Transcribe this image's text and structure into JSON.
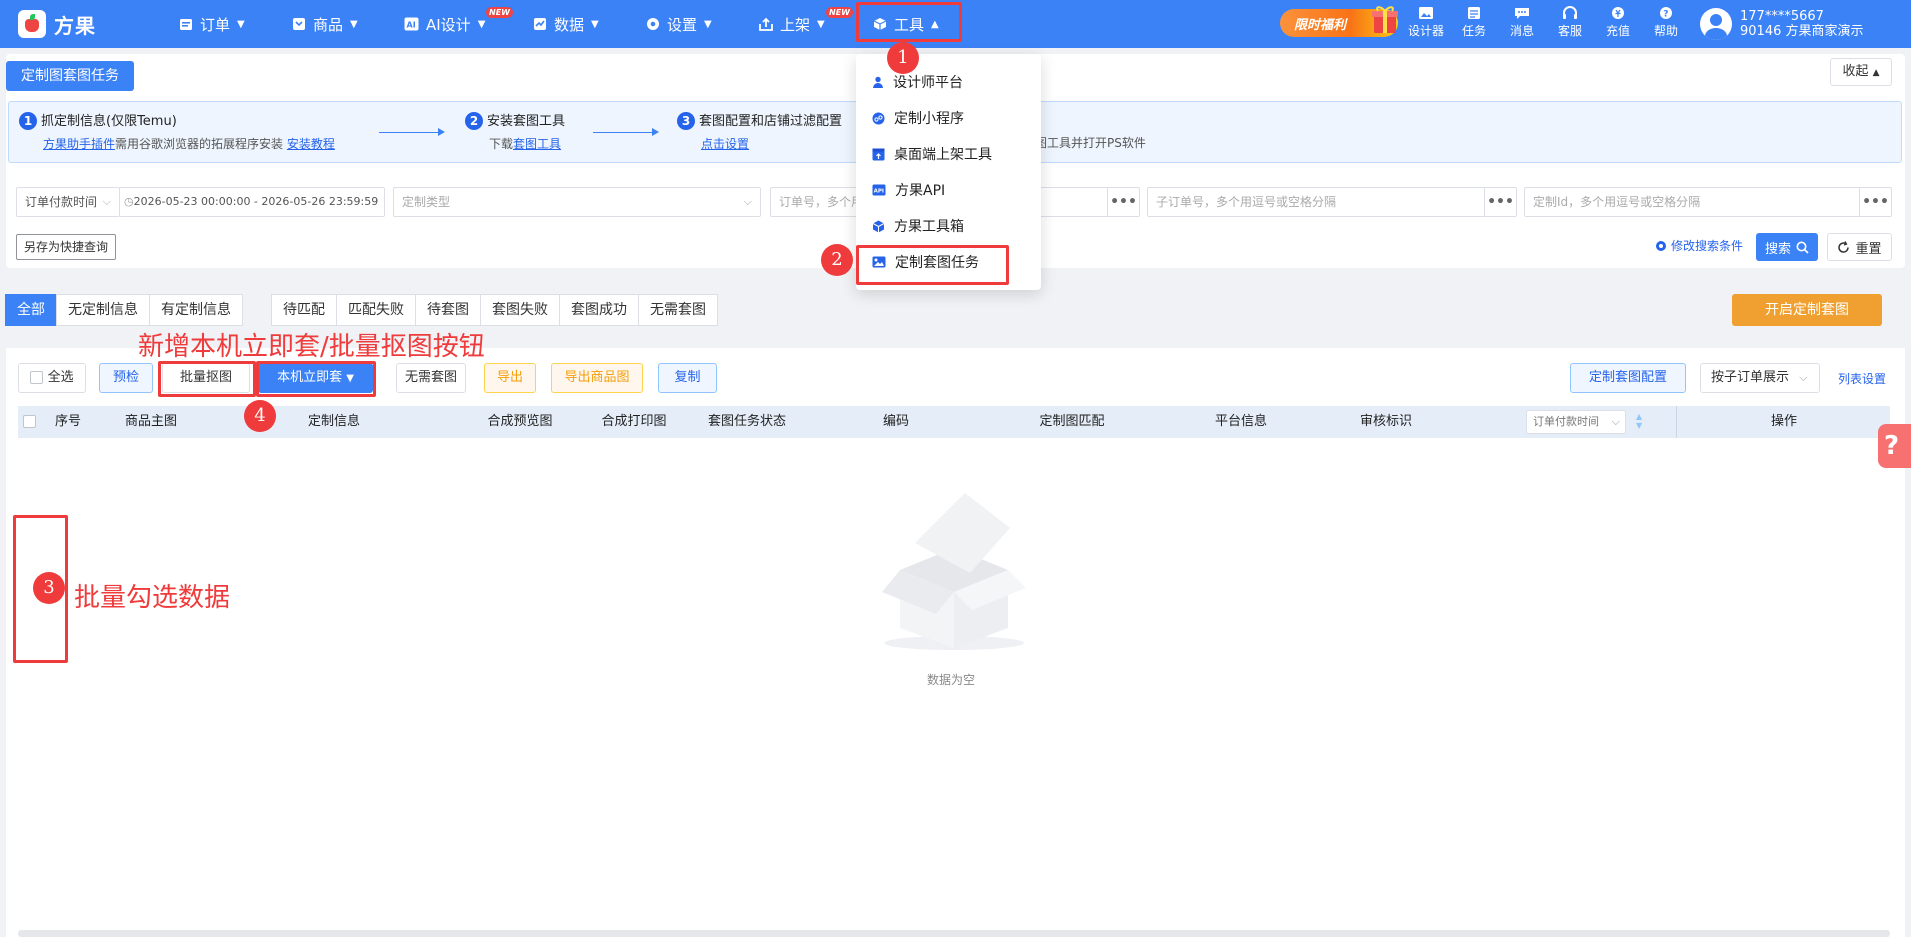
{
  "app": {
    "logo_text": "方果"
  },
  "nav": {
    "items": [
      {
        "label": "订单",
        "icon": "order-icon"
      },
      {
        "label": "商品",
        "icon": "product-icon"
      },
      {
        "label": "AI设计",
        "icon": "ai-icon",
        "badge": "NEW"
      },
      {
        "label": "数据",
        "icon": "chart-icon"
      },
      {
        "label": "设置",
        "icon": "gear-icon"
      },
      {
        "label": "上架",
        "icon": "upload-icon",
        "badge": "NEW"
      },
      {
        "label": "工具",
        "icon": "cube-icon"
      }
    ],
    "promo": "限时福利",
    "tools": [
      {
        "label": "设计器",
        "icon": "image-icon"
      },
      {
        "label": "任务",
        "icon": "task-icon"
      },
      {
        "label": "消息",
        "icon": "message-icon"
      },
      {
        "label": "客服",
        "icon": "headset-icon"
      },
      {
        "label": "充值",
        "icon": "recharge-icon"
      },
      {
        "label": "帮助",
        "icon": "help-icon"
      }
    ],
    "user": {
      "phone": "177****5667",
      "account": "90146 方果商家演示"
    }
  },
  "page": {
    "task_tag": "定制图套图任务",
    "collapse": "收起",
    "steps": [
      {
        "num": "1",
        "title": "抓定制信息(仅限Temu)",
        "desc_link1": "方果助手插件",
        "desc_text": "需用谷歌浏览器的拓展程序安装",
        "desc_link2": "安装教程"
      },
      {
        "num": "2",
        "title": "安装套图工具",
        "desc_text": "下载",
        "desc_link1": "套图工具"
      },
      {
        "num": "3",
        "title": "套图配置和店铺过滤配置",
        "desc_link1": "点击设置"
      },
      {
        "desc_text": "图工具并打开PS软件"
      }
    ]
  },
  "filters": {
    "date_type": "订单付款时间",
    "date_range": "2026-05-23 00:00:00 - 2026-05-26 23:59:59",
    "custom_type_placeholder": "定制类型",
    "order_placeholder": "订单号，多个用",
    "suborder_placeholder": "子订单号，多个用逗号或空格分隔",
    "customid_placeholder": "定制Id，多个用逗号或空格分隔",
    "save_quick": "另存为快捷查询",
    "modify": "修改搜索条件",
    "search": "搜索",
    "reset": "重置"
  },
  "tabs": [
    "全部",
    "无定制信息",
    "有定制信息",
    "待匹配",
    "匹配失败",
    "待套图",
    "套图失败",
    "套图成功",
    "无需套图"
  ],
  "start_button": "开启定制套图",
  "actions": {
    "select_all": "全选",
    "precheck": "预检",
    "batch_cutout": "批量抠图",
    "local_apply": "本机立即套",
    "no_need": "无需套图",
    "export": "导出",
    "export_goods": "导出商品图",
    "copy": "复制",
    "config": "定制套图配置",
    "expand": "按子订单展示",
    "list_settings": "列表设置"
  },
  "table": {
    "columns": [
      "序号",
      "商品主图",
      "定制信息",
      "合成预览图",
      "合成打印图",
      "套图任务状态",
      "编码",
      "定制图匹配",
      "平台信息",
      "审核标识",
      "操作"
    ],
    "sort_field": "订单付款时间",
    "empty": "数据为空"
  },
  "dropdown": {
    "items": [
      {
        "label": "设计师平台",
        "icon": "user-icon"
      },
      {
        "label": "定制小程序",
        "icon": "miniapp-icon"
      },
      {
        "label": "桌面端上架工具",
        "icon": "desktop-upload-icon"
      },
      {
        "label": "方果API",
        "icon": "api-icon"
      },
      {
        "label": "方果工具箱",
        "icon": "toolbox-icon"
      },
      {
        "label": "定制套图任务",
        "icon": "picture-icon"
      }
    ]
  },
  "annotations": {
    "m1": "1",
    "m2": "2",
    "m3": "3",
    "m4": "4",
    "text_new": "新增本机立即套/批量抠图按钮",
    "text_batch": "批量勾选数据"
  },
  "colors": {
    "primary": "#3b82f6",
    "accent_orange": "#f0a030",
    "annotation_red": "#ef3b3b"
  }
}
